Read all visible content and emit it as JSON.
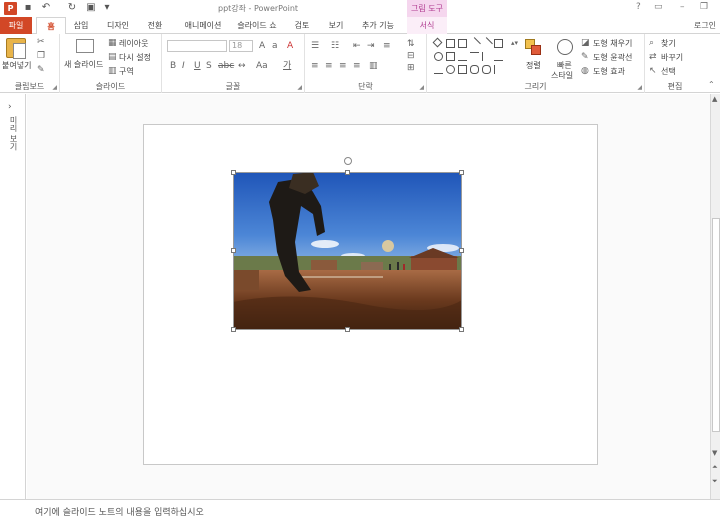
{
  "titlebar": {
    "app_icon": "P",
    "title": "ppt강좌 - PowerPoint",
    "tool_header": "그림 도구",
    "help": "?",
    "colors": {
      "accent": "#d24726",
      "tool": "#b03a90"
    }
  },
  "tabs": [
    {
      "label": "파일"
    },
    {
      "label": "홈"
    },
    {
      "label": "삽입"
    },
    {
      "label": "디자인"
    },
    {
      "label": "전환"
    },
    {
      "label": "애니메이션"
    },
    {
      "label": "슬라이드 쇼"
    },
    {
      "label": "검토"
    },
    {
      "label": "보기"
    },
    {
      "label": "추가 기능"
    },
    {
      "label": "서식"
    }
  ],
  "login": "로그인",
  "ribbon": {
    "clipboard": {
      "paste": "붙여넣기",
      "label": "클립보드"
    },
    "slides": {
      "new_slide": "새 슬라이드",
      "layout": "레이아웃",
      "reset": "다시 설정",
      "section": "구역",
      "label": "슬라이드"
    },
    "font": {
      "size": "18",
      "label": "글꼴"
    },
    "paragraph": {
      "label": "단락"
    },
    "drawing": {
      "arrange": "정렬",
      "quick_style_1": "빠른",
      "quick_style_2": "스타일",
      "fill": "도형 채우기",
      "outline": "도형 윤곽선",
      "effects": "도형 효과",
      "label": "그리기"
    },
    "editing": {
      "find": "찾기",
      "replace": "바꾸기",
      "select": "선택",
      "label": "편집"
    }
  },
  "left_panel": {
    "label": "미리 보기"
  },
  "notes": {
    "placeholder": "여기에 슬라이드 노트의 내용을 입력하십시오"
  }
}
